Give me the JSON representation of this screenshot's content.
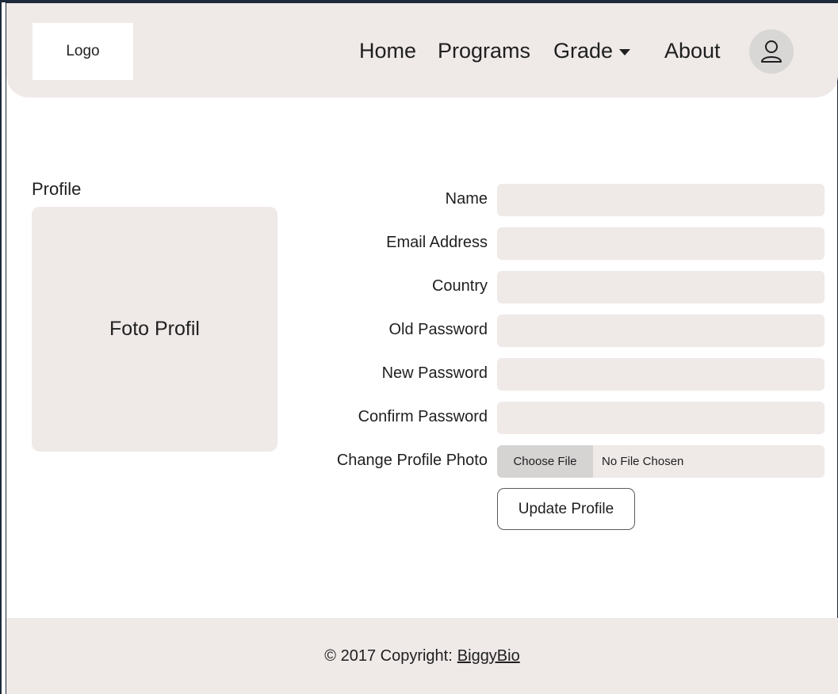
{
  "header": {
    "logo_label": "Logo",
    "nav": {
      "home": "Home",
      "programs": "Programs",
      "grade": "Grade",
      "about": "About"
    },
    "icons": {
      "dropdown": "caret-down-icon",
      "account": "user-icon"
    }
  },
  "profile": {
    "heading": "Profile",
    "photo_placeholder": "Foto Profil"
  },
  "form": {
    "fields": [
      {
        "label": "Name",
        "value": ""
      },
      {
        "label": "Email Address",
        "value": ""
      },
      {
        "label": "Country",
        "value": ""
      },
      {
        "label": "Old Password",
        "value": ""
      },
      {
        "label": "New Password",
        "value": ""
      },
      {
        "label": "Confirm Password",
        "value": ""
      }
    ],
    "photo_label": "Change Profile Photo",
    "choose_file": "Choose File",
    "file_status": "No File Chosen",
    "submit_label": "Update Profile"
  },
  "footer": {
    "copyright": "© 2017 Copyright:",
    "link_text": "BiggyBio"
  },
  "colors": {
    "panel": "#efe9e8",
    "avatar_bg": "#d9d6d6",
    "choose_button": "#d6d3d3",
    "frame_border": "#1c2a3a"
  }
}
